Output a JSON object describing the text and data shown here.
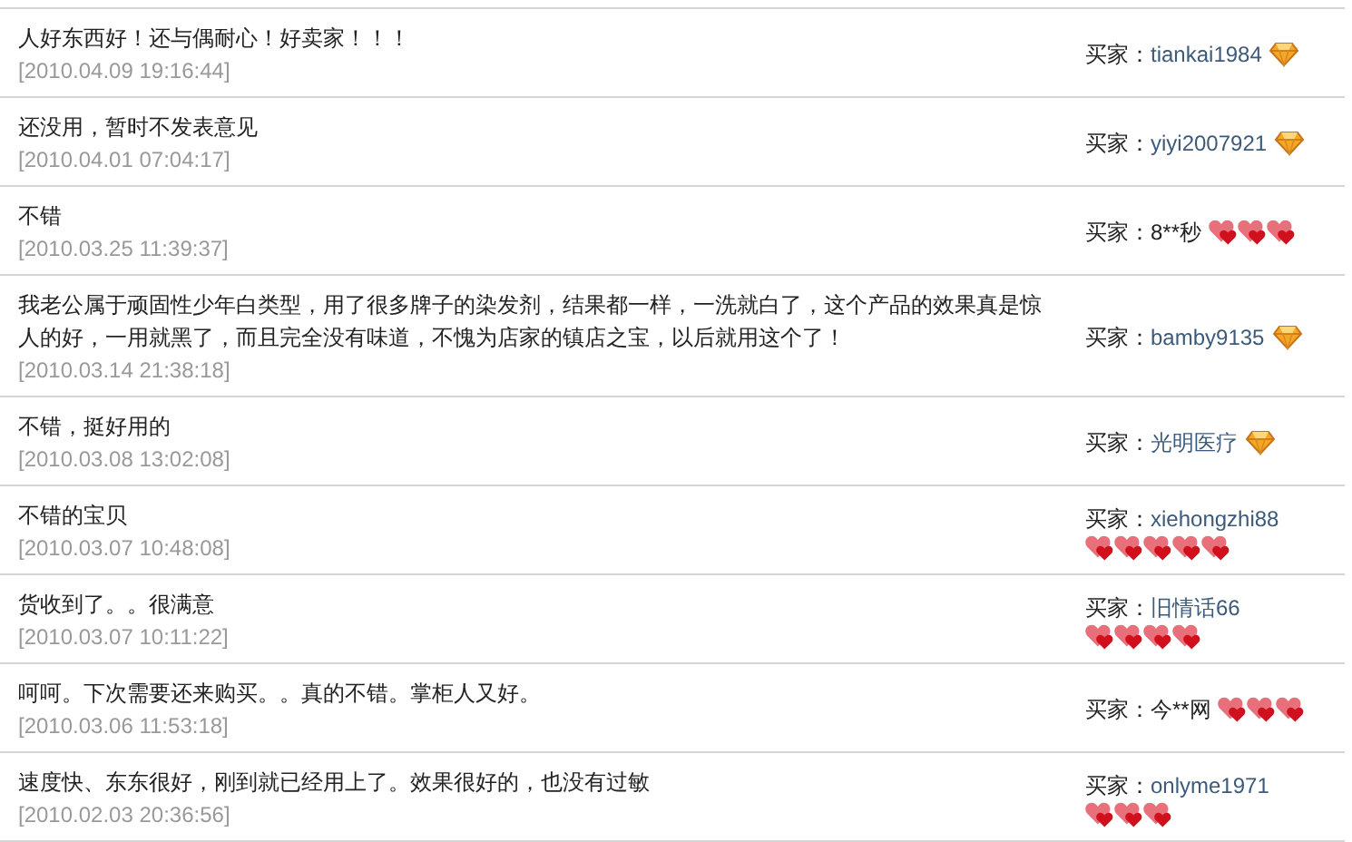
{
  "reviews": [
    {
      "comment": "人好东西好！还与偶耐心！好卖家！！！",
      "date": "[2010.04.09 19:16:44]",
      "buyer_label": "买家：",
      "buyer": "tiankai1984",
      "anonymous": false,
      "badges": [
        {
          "kind": "diamond"
        }
      ]
    },
    {
      "comment": "还没用，暂时不发表意见",
      "date": "[2010.04.01 07:04:17]",
      "buyer_label": "买家：",
      "buyer": "yiyi2007921",
      "anonymous": false,
      "badges": [
        {
          "kind": "diamond"
        }
      ]
    },
    {
      "comment": "不错",
      "date": "[2010.03.25 11:39:37]",
      "buyer_label": "买家：",
      "buyer": "8**秒",
      "anonymous": true,
      "badges": [
        {
          "kind": "heart"
        },
        {
          "kind": "heart"
        },
        {
          "kind": "heart"
        }
      ]
    },
    {
      "comment": "我老公属于顽固性少年白类型，用了很多牌子的染发剂，结果都一样，一洗就白了，这个产品的效果真是惊人的好，一用就黑了，而且完全没有味道，不愧为店家的镇店之宝，以后就用这个了！",
      "date": "[2010.03.14 21:38:18]",
      "buyer_label": "买家：",
      "buyer": "bamby9135",
      "anonymous": false,
      "badges": [
        {
          "kind": "diamond"
        }
      ]
    },
    {
      "comment": "不错，挺好用的",
      "date": "[2010.03.08 13:02:08]",
      "buyer_label": "买家：",
      "buyer": "光明医疗",
      "anonymous": false,
      "badges": [
        {
          "kind": "diamond"
        }
      ]
    },
    {
      "comment": "不错的宝贝",
      "date": "[2010.03.07 10:48:08]",
      "buyer_label": "买家：",
      "buyer": "xiehongzhi88",
      "anonymous": false,
      "badges": [
        {
          "kind": "heart"
        },
        {
          "kind": "heart"
        },
        {
          "kind": "heart"
        },
        {
          "kind": "heart"
        },
        {
          "kind": "heart"
        }
      ]
    },
    {
      "comment": "货收到了。。很满意",
      "date": "[2010.03.07 10:11:22]",
      "buyer_label": "买家：",
      "buyer": "旧情话66",
      "anonymous": false,
      "badges": [
        {
          "kind": "heart"
        },
        {
          "kind": "heart"
        },
        {
          "kind": "heart"
        },
        {
          "kind": "heart"
        }
      ]
    },
    {
      "comment": "呵呵。下次需要还来购买。。真的不错。掌柜人又好。",
      "date": "[2010.03.06 11:53:18]",
      "buyer_label": "买家：",
      "buyer": "今**网",
      "anonymous": true,
      "badges": [
        {
          "kind": "heart"
        },
        {
          "kind": "heart"
        },
        {
          "kind": "heart"
        }
      ]
    },
    {
      "comment": "速度快、东东很好，刚到就已经用上了。效果很好的，也没有过敏",
      "date": "[2010.02.03 20:36:56]",
      "buyer_label": "买家：",
      "buyer": "onlyme1971",
      "anonymous": false,
      "badges": [
        {
          "kind": "heart"
        },
        {
          "kind": "heart"
        },
        {
          "kind": "heart"
        }
      ]
    }
  ]
}
